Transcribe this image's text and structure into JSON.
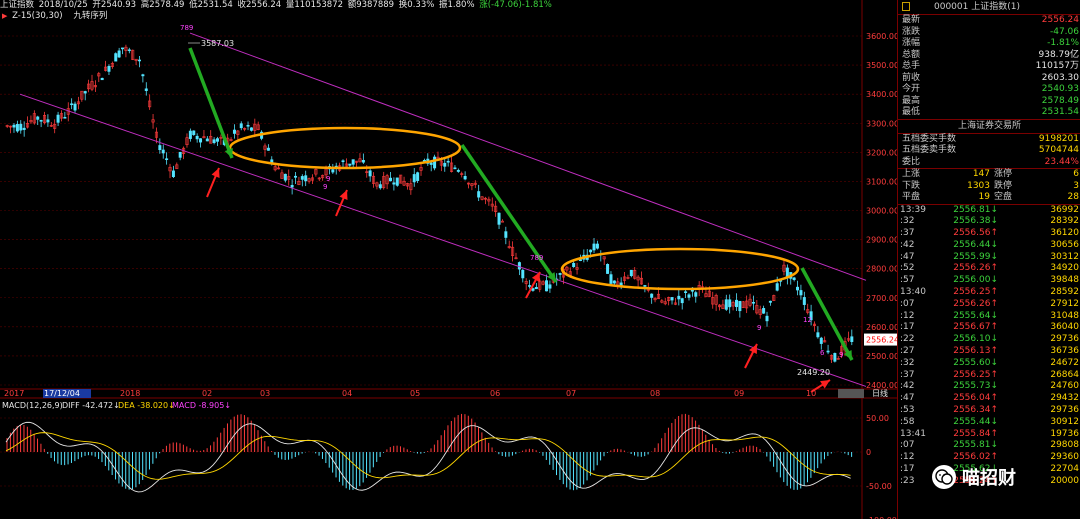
{
  "header": {
    "name": "上证指数",
    "date": "2018/10/25",
    "open": "开2540.93",
    "high": "高2578.49",
    "low": "低2531.54",
    "close": "收2556.24",
    "volume": "量110153872",
    "amount": "额9387889",
    "turnover": "换0.33%",
    "amplitude": "振1.80%",
    "change": "涨(-47.06)-1.81%"
  },
  "indicator_line": {
    "name": "Z-15(30,30)",
    "series": "九转序列"
  },
  "main_chart": {
    "type": "candlestick",
    "y_ticks": [
      "3600.00",
      "3500.00",
      "3400.00",
      "3300.00",
      "3200.00",
      "3100.00",
      "3000.00",
      "2900.00",
      "2800.00",
      "2700.00",
      "2600.00",
      "2500.00",
      "2400.00"
    ],
    "x_labels": [
      "2017",
      "17/12/04",
      "2018",
      "02",
      "03",
      "04",
      "05",
      "06",
      "07",
      "08",
      "09",
      "10"
    ],
    "period_label": "日线",
    "current_price_tag": "2556.24",
    "annotations": {
      "high_label": "3587.03",
      "low_label": "2449.20",
      "td_labels": [
        "789",
        "789",
        "9",
        "9",
        "9",
        "9",
        "12",
        "6"
      ]
    },
    "colors": {
      "up": "#ff3c3c",
      "down": "#54e4ff",
      "channel": "#c02ec0",
      "ellipse": "#ffa500",
      "arrow_green": "#22aa22",
      "arrow_red": "#ff2020"
    }
  },
  "chart_data": {
    "type": "candlestick",
    "title": "上证指数",
    "ylim": [
      2400,
      3650
    ],
    "x_months": [
      "17/12",
      "01",
      "02",
      "03",
      "04",
      "05",
      "06",
      "07",
      "08",
      "09",
      "10"
    ],
    "closes_weekly": [
      3290,
      3320,
      3300,
      3350,
      3420,
      3480,
      3560,
      3520,
      3250,
      3130,
      3260,
      3250,
      3230,
      3280,
      3280,
      3150,
      3100,
      3120,
      3130,
      3160,
      3170,
      3090,
      3110,
      3090,
      3170,
      3160,
      3140,
      3060,
      3000,
      2860,
      2740,
      2740,
      2780,
      2820,
      2880,
      2740,
      2790,
      2720,
      2680,
      2700,
      2730,
      2690,
      2670,
      2680,
      2640,
      2800,
      2720,
      2580,
      2490,
      2560
    ]
  },
  "macd": {
    "label": "MACD(12,26,9)",
    "diff": "DIFF -42.472↓",
    "dea": "DEA -38.020↓",
    "macd": "MACD -8.905↓",
    "y_ticks": [
      "50.00",
      "0",
      "-50.00",
      "-100.00"
    ]
  },
  "right_panel": {
    "code_title": "000001 上证指数(1)",
    "quote": [
      {
        "label": "最新",
        "value": "2556.24",
        "color": "#ff3c3c"
      },
      {
        "label": "涨跌",
        "value": "-47.06",
        "color": "#3cd23c"
      },
      {
        "label": "涨幅",
        "value": "-1.81%",
        "color": "#3cd23c"
      },
      {
        "label": "总额",
        "value": "938.79亿",
        "color": "#e6e6e6"
      },
      {
        "label": "总手",
        "value": "110157万",
        "color": "#e6e6e6"
      },
      {
        "label": "前收",
        "value": "2603.30",
        "color": "#e6e6e6"
      },
      {
        "label": "今开",
        "value": "2540.93",
        "color": "#3cd23c"
      },
      {
        "label": "最高",
        "value": "2578.49",
        "color": "#3cd23c"
      },
      {
        "label": "最低",
        "value": "2531.54",
        "color": "#3cd23c"
      }
    ],
    "exchange": "上海证券交易所",
    "orders": [
      {
        "label": "五档委买手数",
        "value": "9198201",
        "color": "#ffd700"
      },
      {
        "label": "五档委卖手数",
        "value": "5704744",
        "color": "#ffd700"
      },
      {
        "label": "委比",
        "value": "23.44%",
        "color": "#ff3c3c"
      }
    ],
    "advance": [
      {
        "a": "上涨",
        "b": "147",
        "c": "涨停",
        "d": "6"
      },
      {
        "a": "下跌",
        "b": "1303",
        "c": "跌停",
        "d": "3"
      },
      {
        "a": "平盘",
        "b": "19",
        "c": "空盘",
        "d": "28"
      }
    ],
    "ticks": [
      {
        "t": "13:39",
        "p": "2556.81↓",
        "v": "36992"
      },
      {
        "t": ":32",
        "p": "2556.38↓",
        "v": "28392"
      },
      {
        "t": ":37",
        "p": "2556.56↑",
        "v": "36120"
      },
      {
        "t": ":42",
        "p": "2556.44↓",
        "v": "30656"
      },
      {
        "t": ":47",
        "p": "2555.99↓",
        "v": "30312"
      },
      {
        "t": ":52",
        "p": "2556.26↑",
        "v": "34920"
      },
      {
        "t": ":57",
        "p": "2556.00↓",
        "v": "39848"
      },
      {
        "t": "13:40",
        "p": "2556.25↑",
        "v": "28592"
      },
      {
        "t": ":07",
        "p": "2556.26↑",
        "v": "27912"
      },
      {
        "t": ":12",
        "p": "2555.64↓",
        "v": "31048"
      },
      {
        "t": ":17",
        "p": "2556.67↑",
        "v": "36040"
      },
      {
        "t": ":22",
        "p": "2556.10↓",
        "v": "29736"
      },
      {
        "t": ":27",
        "p": "2556.13↑",
        "v": "36736"
      },
      {
        "t": ":32",
        "p": "2555.60↓",
        "v": "24672"
      },
      {
        "t": ":37",
        "p": "2556.25↑",
        "v": "26864"
      },
      {
        "t": ":42",
        "p": "2555.73↓",
        "v": "24760"
      },
      {
        "t": ":47",
        "p": "2556.04↑",
        "v": "29432"
      },
      {
        "t": ":53",
        "p": "2556.34↑",
        "v": "29736"
      },
      {
        "t": ":58",
        "p": "2555.44↓",
        "v": "30912"
      },
      {
        "t": "13:41",
        "p": "2555.84↑",
        "v": "19736"
      },
      {
        "t": ":07",
        "p": "2555.81↓",
        "v": "29808"
      },
      {
        "t": ":12",
        "p": "2556.02↑",
        "v": "29360"
      },
      {
        "t": ":17",
        "p": "2555.62↓",
        "v": "22704"
      },
      {
        "t": ":23",
        "p": "2556.24↑",
        "v": "20000"
      }
    ]
  },
  "watermark": "喵招财"
}
